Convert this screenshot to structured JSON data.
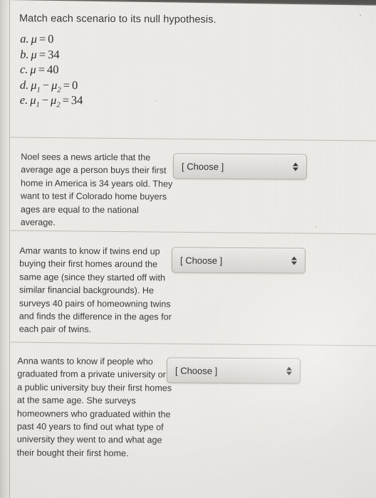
{
  "page": {
    "title": "Match each scenario to its null hypothesis."
  },
  "hypotheses": [
    {
      "label": "a.",
      "expr_html": "<span class=\"var\">&mu;</span><span class=\"op\">=</span>0"
    },
    {
      "label": "b.",
      "expr_html": "<span class=\"var\">&mu;</span><span class=\"op\">=</span>34"
    },
    {
      "label": "c.",
      "expr_html": "<span class=\"var\">&mu;</span><span class=\"op\">=</span>40"
    },
    {
      "label": "d.",
      "expr_html": "<span class=\"var\">&mu;</span><sub>1</sub><span class=\"op\">&minus;</span><span class=\"var\">&mu;</span><sub>2</sub><span class=\"op\">=</span>0"
    },
    {
      "label": "e.",
      "expr_html": "<span class=\"var\">&mu;</span><sub>1</sub><span class=\"op\">&minus;</span><span class=\"var\">&mu;</span><sub>2</sub><span class=\"op\">=</span>34"
    }
  ],
  "hypotheses_plain": [
    "a. μ = 0",
    "b. μ = 34",
    "c. μ = 40",
    "d. μ₁ − μ₂ = 0",
    "e. μ₁ − μ₂ = 34"
  ],
  "scenarios": [
    {
      "text": "Noel sees a news article that the average age a person buys their first home in America is 34 years old. They want to test if Colorado home buyers ages are equal to the national average.",
      "dropdown": {
        "value": "[ Choose ]",
        "options": [
          "[ Choose ]"
        ]
      }
    },
    {
      "text": "Amar wants to know if twins end up buying their first homes around the same age (since they started off with similar financial backgrounds). He surveys 40 pairs of homeowning twins and finds the difference in the ages for each pair of twins.",
      "dropdown": {
        "value": "[ Choose ]",
        "options": [
          "[ Choose ]"
        ]
      }
    },
    {
      "text": "Anna wants to know if people who graduated from a private university or a public university buy their first homes at the same age. She surveys homeowners who graduated within the past 40 years to find out what type of university they went to and what age their bought their first home.",
      "dropdown": {
        "value": "[ Choose ]",
        "options": [
          "[ Choose ]"
        ]
      }
    }
  ],
  "colors": {
    "page_background": "#edebe7",
    "text": "#3b3a38",
    "separator": "#b9b6b1",
    "dropdown_border": "#b3b0ab",
    "bezel": "#575552"
  }
}
